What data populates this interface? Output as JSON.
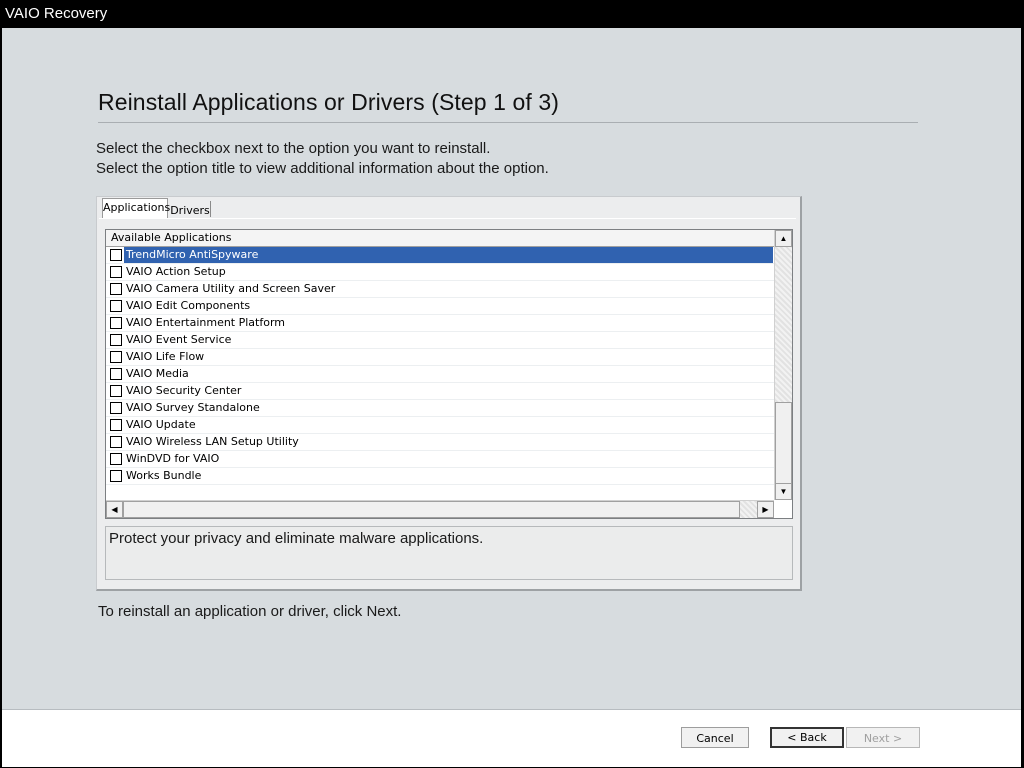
{
  "window": {
    "title": "VAIO Recovery"
  },
  "page": {
    "heading": "Reinstall Applications or Drivers (Step 1 of 3)",
    "instruction_1": "Select the checkbox next to the option you want to reinstall.",
    "instruction_2": "Select the option title to view additional information about the option.",
    "footer_note": "To reinstall an application or driver, click Next."
  },
  "tabs": [
    {
      "label": "Applications",
      "selected": true
    },
    {
      "label": "Drivers",
      "selected": false
    }
  ],
  "list": {
    "header": "Available Applications",
    "items": [
      {
        "label": "TrendMicro AntiSpyware",
        "checked": false,
        "selected": true
      },
      {
        "label": "VAIO Action Setup",
        "checked": false
      },
      {
        "label": "VAIO Camera Utility and Screen Saver",
        "checked": false
      },
      {
        "label": "VAIO Edit Components",
        "checked": false
      },
      {
        "label": "VAIO Entertainment Platform",
        "checked": false
      },
      {
        "label": "VAIO Event Service",
        "checked": false
      },
      {
        "label": "VAIO Life Flow",
        "checked": false
      },
      {
        "label": "VAIO Media",
        "checked": false
      },
      {
        "label": "VAIO Security Center",
        "checked": false
      },
      {
        "label": "VAIO Survey Standalone",
        "checked": false
      },
      {
        "label": "VAIO Update",
        "checked": false
      },
      {
        "label": "VAIO Wireless LAN Setup Utility",
        "checked": false
      },
      {
        "label": "WinDVD for VAIO",
        "checked": false
      },
      {
        "label": "Works Bundle",
        "checked": false
      }
    ]
  },
  "description": "Protect your privacy and eliminate malware applications.",
  "buttons": {
    "cancel": "Cancel",
    "back": "< Back",
    "next": "Next >"
  },
  "colors": {
    "selection": "#3062b0",
    "background": "#d7dcdf"
  }
}
